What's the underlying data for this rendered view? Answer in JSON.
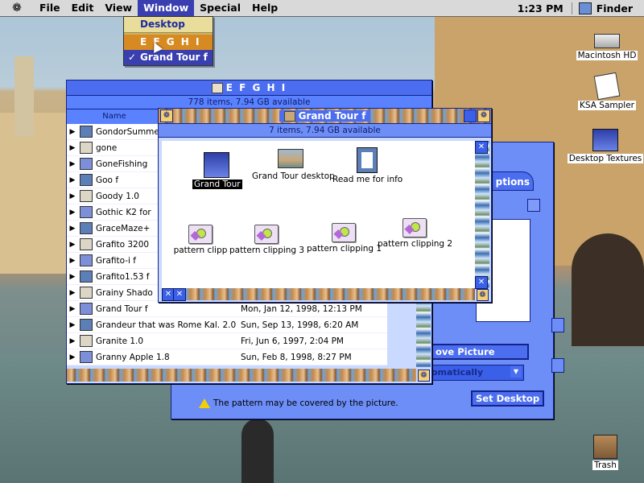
{
  "menubar": {
    "items": [
      "File",
      "Edit",
      "View",
      "Window",
      "Special",
      "Help"
    ],
    "clock": "1:23 PM",
    "app": "Finder"
  },
  "window_menu": {
    "items": [
      "Desktop",
      "E F G H I",
      "Grand Tour f"
    ]
  },
  "efghi_window": {
    "title": "E F G H I",
    "info": "778 items, 7.94 GB available",
    "header_name": "Name",
    "rows": [
      {
        "name": "GondorSummer",
        "date": ""
      },
      {
        "name": "gone",
        "date": ""
      },
      {
        "name": "GoneFishing",
        "date": ""
      },
      {
        "name": "Goo f",
        "date": ""
      },
      {
        "name": "Goody 1.0",
        "date": ""
      },
      {
        "name": "Gothic K2 for",
        "date": ""
      },
      {
        "name": "GraceMaze+",
        "date": ""
      },
      {
        "name": "Grafito 3200",
        "date": ""
      },
      {
        "name": "Grafito-i f",
        "date": ""
      },
      {
        "name": "Grafito1.53 f",
        "date": ""
      },
      {
        "name": "Grainy Shado",
        "date": ""
      },
      {
        "name": "Grand Tour f",
        "date": "Mon, Jan 12, 1998, 12:13 PM"
      },
      {
        "name": "Grandeur that was Rome Kal. 2.0",
        "date": "Sun, Sep 13, 1998, 6:20 AM"
      },
      {
        "name": "Granite 1.0",
        "date": "Fri, Jun 6, 1997, 2:04 PM"
      },
      {
        "name": "Granny Apple 1.8",
        "date": "Sun, Feb 8, 1998, 8:27 PM"
      }
    ]
  },
  "grandtour_window": {
    "title": "Grand Tour f",
    "info": "7 items, 7.94 GB available",
    "icons": [
      {
        "label": "Grand Tour",
        "selected": true,
        "kind": "app"
      },
      {
        "label": "Grand Tour desktop",
        "selected": false,
        "kind": "picture"
      },
      {
        "label": "Read me for info",
        "selected": false,
        "kind": "doc"
      },
      {
        "label": "pattern clipp",
        "selected": false,
        "kind": "clip"
      },
      {
        "label": "pattern clipping 3",
        "selected": false,
        "kind": "clip"
      },
      {
        "label": "pattern clipping 1",
        "selected": false,
        "kind": "clip"
      },
      {
        "label": "pattern clipping 2",
        "selected": false,
        "kind": "clip"
      }
    ]
  },
  "desktop_textures_window": {
    "tab_label": "ptions",
    "picture_button": "ove Picture",
    "position_popup": "omatically",
    "set_desktop_button": "Set Desktop",
    "warning": "The pattern may be covered by the picture."
  },
  "desktop_icons": [
    "Macintosh HD",
    "KSA Sampler",
    "Desktop Textures",
    "Trash"
  ],
  "colors": {
    "window_blue": "#4b6df0",
    "menu_highlight": "#3a3fb0",
    "menu_selected": "#d88a22"
  }
}
